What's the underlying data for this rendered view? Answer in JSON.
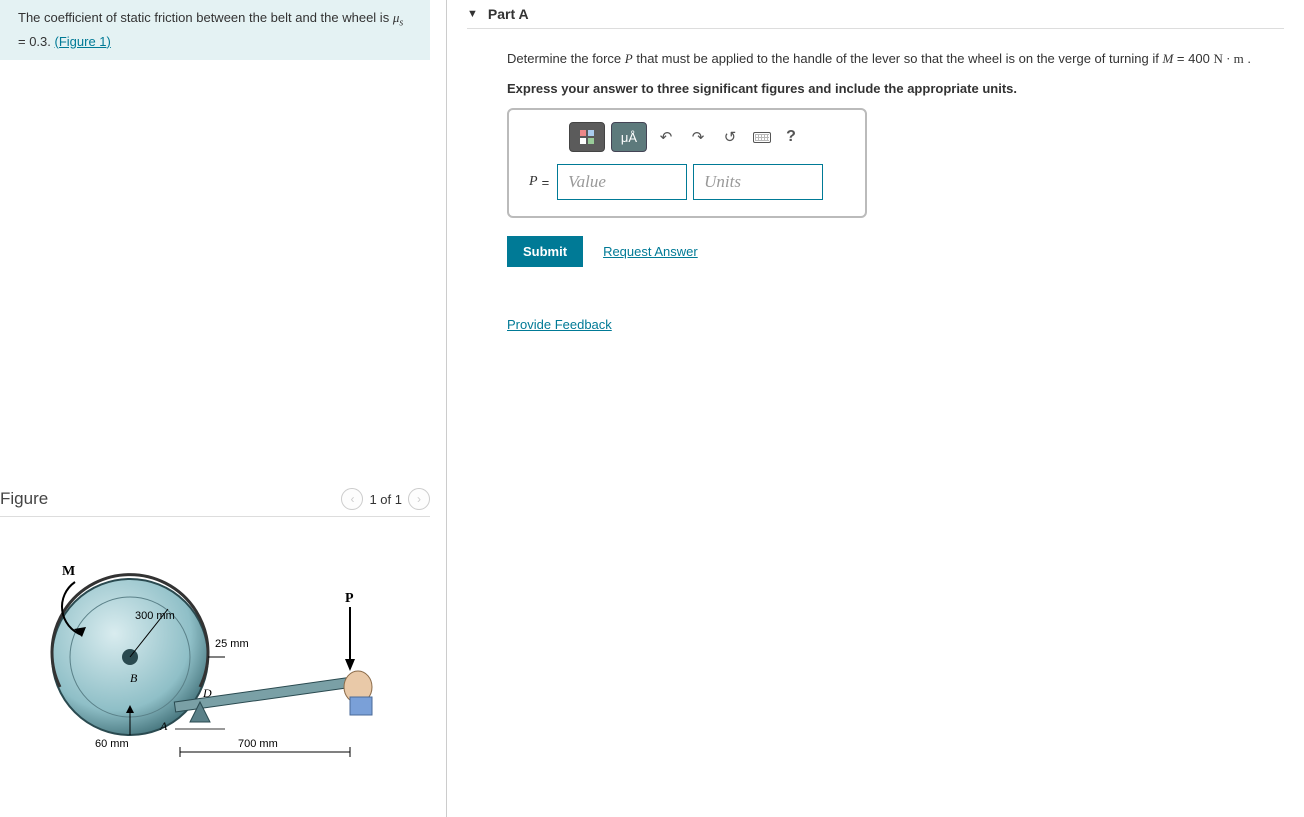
{
  "problem": {
    "text_prefix": "The coefficient of static friction between the belt and the wheel is ",
    "mu_symbol": "μ",
    "mu_sub": "s",
    "eq": " = 0.3. ",
    "figure_link": "(Figure 1)"
  },
  "figure": {
    "title": "Figure",
    "pager": "1 of 1",
    "labels": {
      "M": "M",
      "P": "P",
      "B": "B",
      "D": "D",
      "A": "A",
      "r_inner": "300 mm",
      "d_offset": "25 mm",
      "h": "60 mm",
      "lever": "700 mm"
    }
  },
  "part": {
    "title": "Part A",
    "prompt_before": "Determine the force ",
    "prompt_var": "P",
    "prompt_mid": " that must be applied to the handle of the lever so that the wheel is on the verge of turning if ",
    "M_var": "M",
    "M_eq": " = 400  ",
    "M_units": "N · m",
    "prompt_after": " .",
    "instruction": "Express your answer to three significant figures and include the appropriate units.",
    "var_label": "P",
    "value_placeholder": "Value",
    "units_placeholder": "Units",
    "submit": "Submit",
    "request_answer": "Request Answer",
    "greek_btn": "μÅ"
  },
  "feedback": "Provide Feedback"
}
